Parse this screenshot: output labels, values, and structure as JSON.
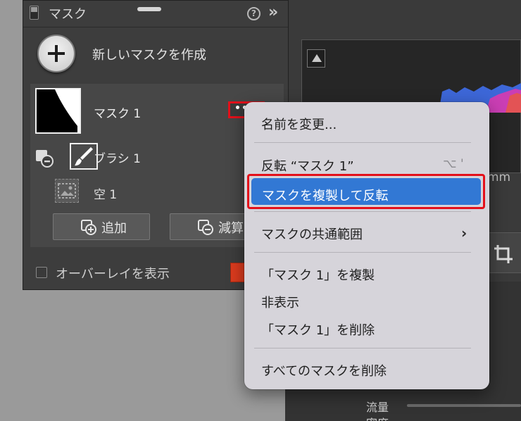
{
  "panel": {
    "title": "マスク",
    "help_symbol": "?",
    "collapse_symbol": "»"
  },
  "new_mask": {
    "label": "新しいマスクを作成"
  },
  "masks": [
    {
      "name": "マスク 1",
      "more_symbol": "••",
      "components": [
        {
          "name": "ブラシ 1",
          "icon": "brush-icon",
          "mode": "subtract"
        },
        {
          "name": "空 1",
          "icon": "sky-icon"
        }
      ]
    }
  ],
  "buttons": {
    "add_label": "追加",
    "subtract_label": "減算"
  },
  "overlay": {
    "label": "オーバーレイを表示",
    "color": "#dc3b1e"
  },
  "background": {
    "unit_text": "mm",
    "slider_label_1": "流量",
    "slider_label_2": "密度"
  },
  "context_menu": {
    "items": {
      "rename": "名前を変更...",
      "invert": "反転 “マスク 1”",
      "invert_shortcut": "⌥ '",
      "duplicate_invert": "マスクを複製して反転",
      "intersect": "マスクの共通範囲",
      "intersect_arrow": "›",
      "duplicate": "「マスク 1」を複製",
      "hide": "非表示",
      "delete": "「マスク 1」を削除",
      "delete_all": "すべてのマスクを削除"
    },
    "highlight_color": "#3278d4",
    "annotation_color": "#e4101a"
  }
}
